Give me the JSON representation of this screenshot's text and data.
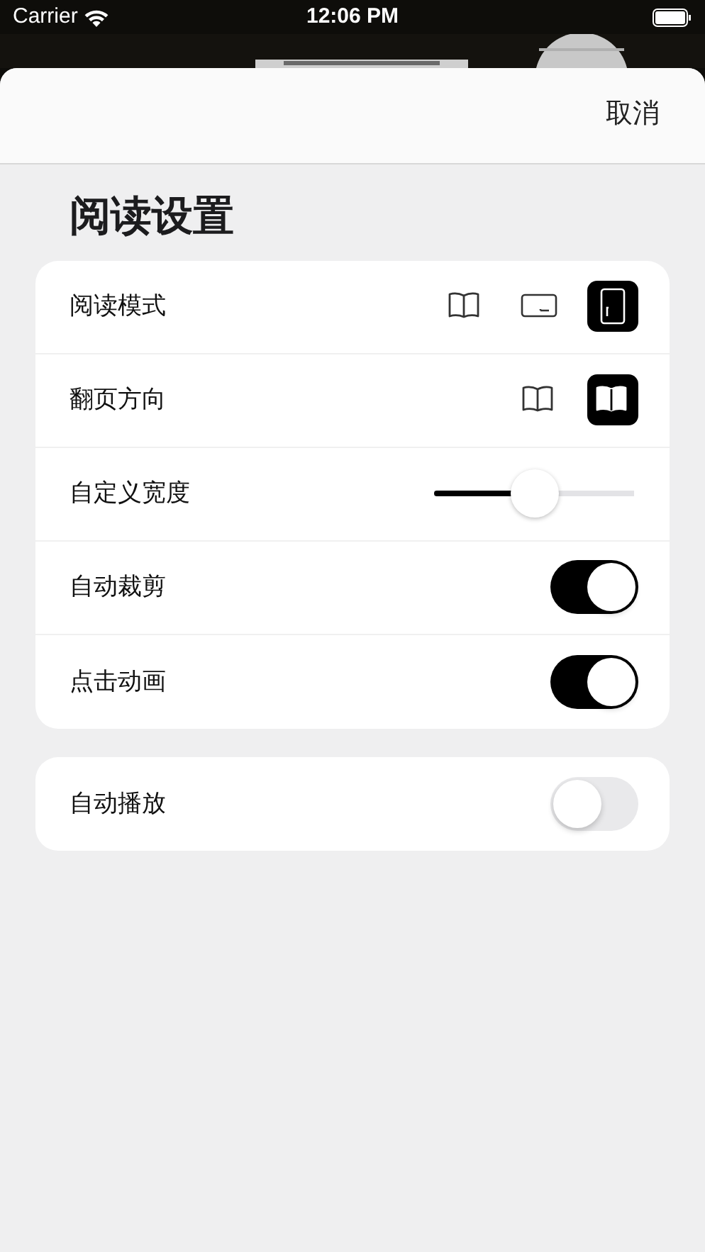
{
  "status_bar": {
    "carrier": "Carrier",
    "time": "12:06 PM"
  },
  "header": {
    "cancel": "取消"
  },
  "title": "阅读设置",
  "groups": [
    {
      "rows": [
        {
          "kind": "options",
          "label": "阅读模式",
          "options": [
            {
              "kind": "book",
              "selected": false
            },
            {
              "kind": "horizontal",
              "selected": false
            },
            {
              "kind": "vertical",
              "selected": true
            }
          ]
        },
        {
          "kind": "options",
          "label": "翻页方向",
          "options": [
            {
              "kind": "book",
              "selected": false
            },
            {
              "kind": "book",
              "selected": true
            }
          ]
        },
        {
          "kind": "slider",
          "label": "自定义宽度",
          "level": 0.5
        },
        {
          "kind": "toggle",
          "label": "自动裁剪",
          "on": true
        },
        {
          "kind": "toggle",
          "label": "点击动画",
          "on": true
        }
      ]
    },
    {
      "rows": [
        {
          "kind": "toggle",
          "label": "自动播放",
          "on": false
        }
      ]
    }
  ]
}
